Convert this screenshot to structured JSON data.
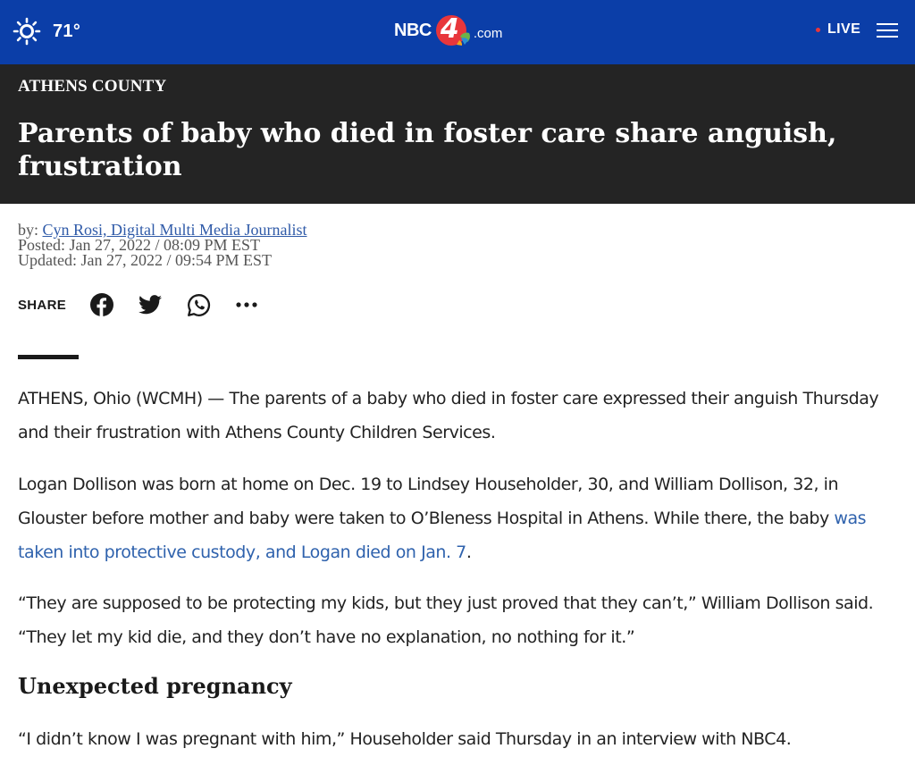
{
  "header": {
    "weather_temp": "71°",
    "logo_text": "NBC",
    "logo_number": "4",
    "logo_suffix": ".com",
    "live_label": "LIVE",
    "brand_color": "#0b3ea8",
    "live_dot_color": "#e8363b",
    "weather_icon": "sun-icon",
    "menu_icon": "hamburger-menu-icon"
  },
  "article": {
    "category": "ATHENS COUNTY",
    "headline": "Parents of baby who died in foster care share anguish, frustration",
    "byline_prefix": "by:",
    "author": "Cyn Rosi, Digital Multi Media Journalist",
    "posted": "Posted: Jan 27, 2022 / 08:09 PM EST",
    "updated": "Updated: Jan 27, 2022 / 09:54 PM EST",
    "share_label": "SHARE",
    "share_icons": [
      "facebook-icon",
      "twitter-icon",
      "whatsapp-icon",
      "more-icon"
    ],
    "paragraphs": {
      "p1": "ATHENS, Ohio (WCMH) — The parents of a baby who died in foster care expressed their anguish Thursday and their frustration with Athens County Children Services.",
      "p2_before_link": "Logan Dollison was born at home on Dec. 19 to Lindsey Householder, 30, and William Dollison, 32, in Glouster before mother and baby were taken to O’Bleness Hospital in Athens. While there, the baby ",
      "p2_link": "was taken into protective custody, and Logan died on Jan. 7",
      "p2_after_link": ".",
      "p3": "“They are supposed to be protecting my kids, but they just proved that they can’t,” William Dollison said. “They let my kid die, and they don’t have no explanation, no nothing for it.”",
      "p4": "“I didn’t know I was pregnant with him,” Householder said Thursday in an interview with NBC4."
    },
    "subheading": "Unexpected pregnancy",
    "link_color": "#2f62ad"
  }
}
